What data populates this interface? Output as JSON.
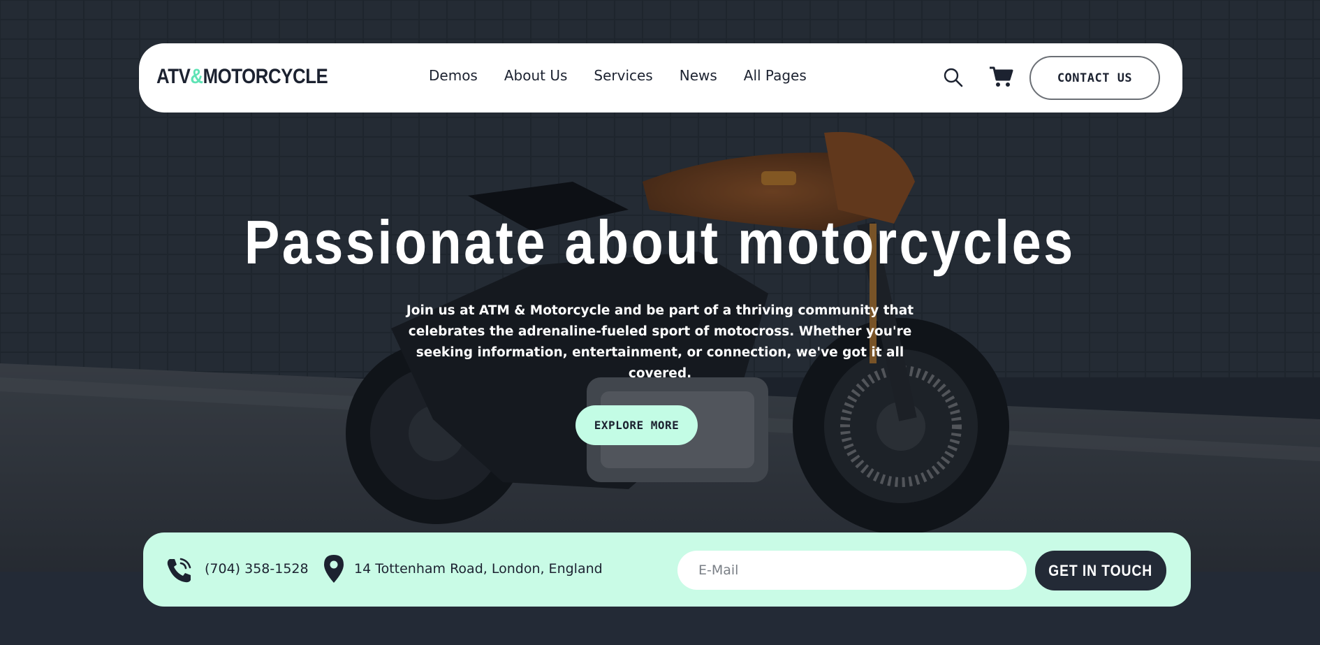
{
  "brand": {
    "logo_left": "ATV",
    "logo_amp": "&",
    "logo_right": "MOTORCYCLE",
    "accent_color": "#5fe3b5"
  },
  "nav": {
    "items": [
      {
        "label": "Demos"
      },
      {
        "label": "About Us"
      },
      {
        "label": "Services"
      },
      {
        "label": "News"
      },
      {
        "label": "All Pages"
      }
    ],
    "search_icon": "search-icon",
    "cart_icon": "cart-icon",
    "contact_label": "CONTACT US"
  },
  "hero": {
    "title": "Passionate about motorcycles",
    "description": "Join us at ATM & Motorcycle and be part of a thriving community that celebrates the adrenaline-fueled sport of motocross. Whether you're seeking information, entertainment, or connection, we've got it all covered.",
    "cta_label": "EXPLORE MORE"
  },
  "contact_bar": {
    "phone": "(704) 358-1528",
    "address": "14 Tottenham Road, London, England",
    "email_placeholder": "E-Mail",
    "submit_label": "GET IN TOUCH",
    "background_color": "#c9fbe6"
  },
  "colors": {
    "dark": "#232a36",
    "mint": "#c3fce5"
  }
}
